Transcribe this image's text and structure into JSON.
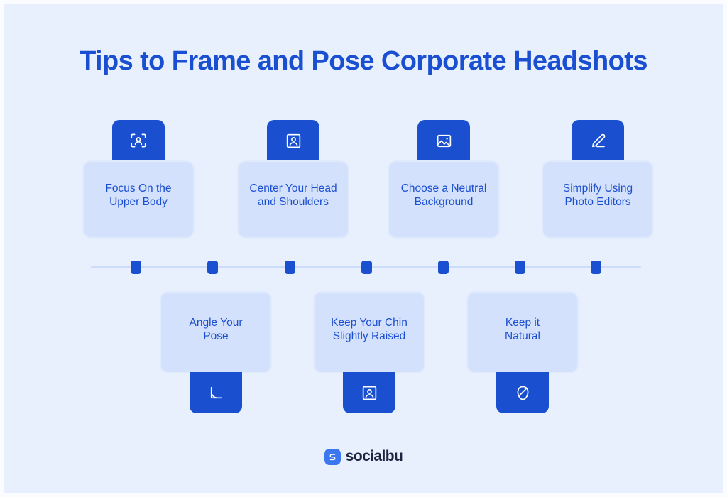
{
  "page": {
    "title": "Tips to Frame and Pose Corporate Headshots",
    "background_color": "#e8f0fd",
    "accent_color": "#1a4fd0",
    "card_color": "#d4e1fc",
    "text_color": "#1b4fd1"
  },
  "top_row": [
    {
      "label": "Focus On the\nUpper Body",
      "icon": "scan-face-icon"
    },
    {
      "label": "Center Your Head\nand Shoulders",
      "icon": "user-square-icon"
    },
    {
      "label": "Choose a Neutral\nBackground",
      "icon": "image-icon"
    },
    {
      "label": "Simplify Using\nPhoto Editors",
      "icon": "pencil-icon"
    }
  ],
  "bottom_row": [
    {
      "label": "Angle Your\nPose",
      "icon": "angle-icon"
    },
    {
      "label": "Keep Your Chin\nSlightly Raised",
      "icon": "user-square-icon"
    },
    {
      "label": "Keep it\nNatural",
      "icon": "leaf-icon"
    }
  ],
  "timeline": {
    "tick_count": 7,
    "line_color": "#cbddfb",
    "tick_color": "#1a4fd0"
  },
  "footer": {
    "brand": "socialbu",
    "mark_letter": "S",
    "mark_color": "#3b78f0"
  }
}
